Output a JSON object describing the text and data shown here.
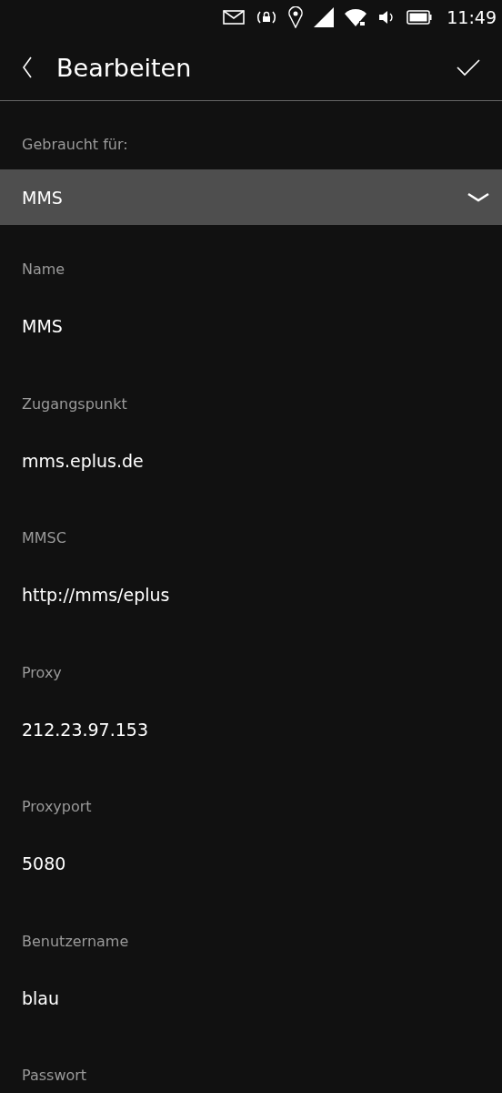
{
  "status_bar": {
    "time": "11:49"
  },
  "header": {
    "title": "Bearbeiten"
  },
  "used_for": {
    "label": "Gebraucht für:",
    "value": "MMS"
  },
  "fields": [
    {
      "label": "Name",
      "value": "MMS"
    },
    {
      "label": "Zugangspunkt",
      "value": "mms.eplus.de"
    },
    {
      "label": "MMSC",
      "value": "http://mms/eplus"
    },
    {
      "label": "Proxy",
      "value": "212.23.97.153"
    },
    {
      "label": "Proxyport",
      "value": "5080"
    },
    {
      "label": "Benutzername",
      "value": "blau"
    },
    {
      "label": "Passwort"
    }
  ]
}
